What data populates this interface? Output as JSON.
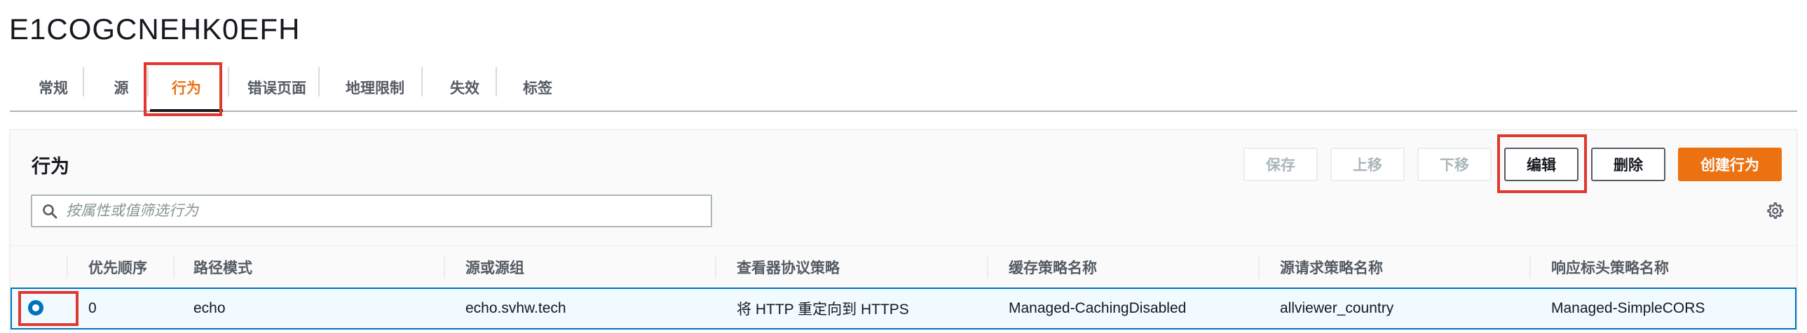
{
  "page_title": "E1COGCNEHK0EFH",
  "tabs": [
    {
      "label": "常规"
    },
    {
      "label": "源"
    },
    {
      "label": "行为",
      "active": true
    },
    {
      "label": "错误页面"
    },
    {
      "label": "地理限制"
    },
    {
      "label": "失效"
    },
    {
      "label": "标签"
    }
  ],
  "panel": {
    "title": "行为",
    "buttons": {
      "save": "保存",
      "move_up": "上移",
      "move_down": "下移",
      "edit": "编辑",
      "delete": "删除",
      "create": "创建行为"
    },
    "search": {
      "placeholder": "按属性或值筛选行为"
    }
  },
  "table": {
    "columns": [
      "优先顺序",
      "路径模式",
      "源或源组",
      "查看器协议策略",
      "缓存策略名称",
      "源请求策略名称",
      "响应标头策略名称"
    ],
    "rows": [
      {
        "selected": true,
        "cells": [
          "0",
          "echo",
          "echo.svhw.tech",
          "将 HTTP 重定向到 HTTPS",
          "Managed-CachingDisabled",
          "allviewer_country",
          "Managed-SimpleCORS"
        ]
      }
    ]
  },
  "colors": {
    "accent": "#ec7211",
    "highlight_box": "#e0372f",
    "selection": "#0073bb"
  },
  "icons": {
    "search": "search-icon",
    "settings": "gear-icon",
    "row_select": "radio-selected-icon"
  }
}
